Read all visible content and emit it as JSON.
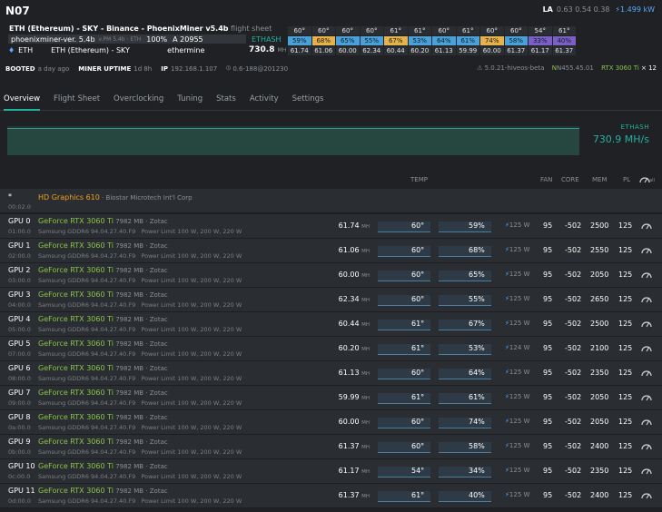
{
  "rig": {
    "name": "N07"
  },
  "la": {
    "label": "LA",
    "values": "0.63 0.54 0.38",
    "power": "⚡1.499 kW"
  },
  "flight_sheet": {
    "title": "ETH (Ethereum) - SKY - Binance - PhoenixMiner v5.4b",
    "suffix": "flight sheet"
  },
  "miner": {
    "name": "phoenixminer-ver. 5.4b",
    "version": "v.PM 5.4b · ETH",
    "percent": "100%",
    "accepted": "A 20955",
    "coin": "ETH",
    "coin_name": "ETH (Ethereum) - SKY",
    "pool": "ethermine",
    "algo": "ETHASH",
    "hashrate": "730.8",
    "hashrate_unit": "MH"
  },
  "gpu_summary": {
    "temps": [
      "60°",
      "60°",
      "60°",
      "60°",
      "61°",
      "61°",
      "60°",
      "61°",
      "60°",
      "60°",
      "54°",
      "61°"
    ],
    "fans": [
      "59%",
      "68%",
      "65%",
      "55%",
      "67%",
      "53%",
      "64%",
      "61%",
      "74%",
      "58%",
      "33%",
      "40%"
    ],
    "fan_colors": [
      "#4aa0d8",
      "#e8b24a",
      "#4aa0d8",
      "#4aa0d8",
      "#e8b24a",
      "#4aa0d8",
      "#4aa0d8",
      "#4aa0d8",
      "#e8b24a",
      "#4aa0d8",
      "#7b5fc4",
      "#7b5fc4"
    ],
    "hashrates": [
      "61.74",
      "61.06",
      "60.00",
      "62.34",
      "60.44",
      "60.20",
      "61.13",
      "59.99",
      "60.00",
      "61.37",
      "61.17",
      "61.37"
    ]
  },
  "info": {
    "booted_label": "BOOTED",
    "booted": "a day ago",
    "uptime_label": "MINER UPTIME",
    "uptime": "1d 8h",
    "ip_label": "IP",
    "ip": "192.168.1.107",
    "build": "0.6-188@201230",
    "os": "5.0.21-hiveos-beta",
    "driver": "N455.45.01",
    "gpu_model": "RTX 3060 Ti",
    "gpu_count": "× 12"
  },
  "tabs": [
    "Overview",
    "Flight Sheet",
    "Overclocking",
    "Tuning",
    "Stats",
    "Activity",
    "Settings"
  ],
  "chart": {
    "algo": "ETHASH",
    "hashrate": "730.9 MH/s"
  },
  "columns": {
    "temp": "TEMP",
    "fan": "FAN",
    "core": "CORE",
    "mem": "MEM",
    "pl": "PL",
    "all": "all"
  },
  "igpu": {
    "id": "*",
    "bus": "00:02.0",
    "name": "HD Graphics 610",
    "vendor": " · Biostar Microtech Int'l Corp"
  },
  "gpus": [
    {
      "id": "GPU 0",
      "bus": "01:00.0",
      "name": "GeForce RTX 3060 Ti",
      "mem_info": " 7982 MB · Zotac",
      "mem": "Samsung GDDR6 94.04.27.40.F9",
      "limit": "Power Limit 100 W, 200 W, 220 W",
      "hr": "61.74",
      "unit": "MH",
      "temp": "60°",
      "fan": "59%",
      "power": "125 W",
      "pct": "95",
      "core": "-502",
      "memclk": "2500",
      "pl": "125"
    },
    {
      "id": "GPU 1",
      "bus": "02:00.0",
      "name": "GeForce RTX 3060 Ti",
      "mem_info": " 7982 MB · Zotac",
      "mem": "Samsung GDDR6 94.04.27.40.F9",
      "limit": "Power Limit 100 W, 200 W, 220 W",
      "hr": "61.06",
      "unit": "MH",
      "temp": "60°",
      "fan": "68%",
      "power": "125 W",
      "pct": "95",
      "core": "-502",
      "memclk": "2550",
      "pl": "125"
    },
    {
      "id": "GPU 2",
      "bus": "03:00.0",
      "name": "GeForce RTX 3060 Ti",
      "mem_info": " 7982 MB · Zotac",
      "mem": "Samsung GDDR6 94.04.27.40.F9",
      "limit": "Power Limit 100 W, 200 W, 220 W",
      "hr": "60.00",
      "unit": "MH",
      "temp": "60°",
      "fan": "65%",
      "power": "125 W",
      "pct": "95",
      "core": "-502",
      "memclk": "2050",
      "pl": "125"
    },
    {
      "id": "GPU 3",
      "bus": "04:00.0",
      "name": "GeForce RTX 3060 Ti",
      "mem_info": " 7982 MB · Zotac",
      "mem": "Samsung GDDR6 94.04.27.40.F9",
      "limit": "Power Limit 100 W, 200 W, 220 W",
      "hr": "62.34",
      "unit": "MH",
      "temp": "60°",
      "fan": "55%",
      "power": "125 W",
      "pct": "95",
      "core": "-502",
      "memclk": "2650",
      "pl": "125"
    },
    {
      "id": "GPU 4",
      "bus": "05:00.0",
      "name": "GeForce RTX 3060 Ti",
      "mem_info": " 7982 MB · Zotac",
      "mem": "Samsung GDDR6 94.04.27.40.F9",
      "limit": "Power Limit 100 W, 200 W, 220 W",
      "hr": "60.44",
      "unit": "MH",
      "temp": "61°",
      "fan": "67%",
      "power": "125 W",
      "pct": "95",
      "core": "-502",
      "memclk": "2500",
      "pl": "125"
    },
    {
      "id": "GPU 5",
      "bus": "07:00.0",
      "name": "GeForce RTX 3060 Ti",
      "mem_info": " 7982 MB · Zotac",
      "mem": "Samsung GDDR6 94.04.27.40.F9",
      "limit": "Power Limit 100 W, 200 W, 220 W",
      "hr": "60.20",
      "unit": "MH",
      "temp": "61°",
      "fan": "53%",
      "power": "124 W",
      "pct": "95",
      "core": "-502",
      "memclk": "2100",
      "pl": "125"
    },
    {
      "id": "GPU 6",
      "bus": "08:00.0",
      "name": "GeForce RTX 3060 Ti",
      "mem_info": " 7982 MB · Zotac",
      "mem": "Samsung GDDR6 94.04.27.40.F9",
      "limit": "Power Limit 100 W, 200 W, 220 W",
      "hr": "61.13",
      "unit": "MH",
      "temp": "60°",
      "fan": "64%",
      "power": "125 W",
      "pct": "95",
      "core": "-502",
      "memclk": "2350",
      "pl": "125"
    },
    {
      "id": "GPU 7",
      "bus": "09:00.0",
      "name": "GeForce RTX 3060 Ti",
      "mem_info": " 7982 MB · Zotac",
      "mem": "Samsung GDDR6 94.04.27.40.F9",
      "limit": "Power Limit 100 W, 200 W, 220 W",
      "hr": "59.99",
      "unit": "MH",
      "temp": "61°",
      "fan": "61%",
      "power": "125 W",
      "pct": "95",
      "core": "-502",
      "memclk": "2050",
      "pl": "125"
    },
    {
      "id": "GPU 8",
      "bus": "0a:00.0",
      "name": "GeForce RTX 3060 Ti",
      "mem_info": " 7982 MB · Zotac",
      "mem": "Samsung GDDR6 94.04.27.40.F9",
      "limit": "Power Limit 100 W, 200 W, 220 W",
      "hr": "60.00",
      "unit": "MH",
      "temp": "60°",
      "fan": "74%",
      "power": "125 W",
      "pct": "95",
      "core": "-502",
      "memclk": "2050",
      "pl": "125"
    },
    {
      "id": "GPU 9",
      "bus": "0b:00.0",
      "name": "GeForce RTX 3060 Ti",
      "mem_info": " 7982 MB · Zotac",
      "mem": "Samsung GDDR6 94.04.27.40.F9",
      "limit": "Power Limit 100 W, 200 W, 220 W",
      "hr": "61.37",
      "unit": "MH",
      "temp": "60°",
      "fan": "58%",
      "power": "125 W",
      "pct": "95",
      "core": "-502",
      "memclk": "2400",
      "pl": "125"
    },
    {
      "id": "GPU 10",
      "bus": "0c:00.0",
      "name": "GeForce RTX 3060 Ti",
      "mem_info": " 7982 MB · Zotac",
      "mem": "Samsung GDDR6 94.04.27.40.F9",
      "limit": "Power Limit 100 W, 200 W, 220 W",
      "hr": "61.17",
      "unit": "MH",
      "temp": "54°",
      "fan": "34%",
      "power": "125 W",
      "pct": "95",
      "core": "-502",
      "memclk": "2350",
      "pl": "125"
    },
    {
      "id": "GPU 11",
      "bus": "0d:00.0",
      "name": "GeForce RTX 3060 Ti",
      "mem_info": " 7982 MB · Zotac",
      "mem": "Samsung GDDR6 94.04.27.40.F9",
      "limit": "Power Limit 100 W, 200 W, 220 W",
      "hr": "61.37",
      "unit": "MH",
      "temp": "61°",
      "fan": "40%",
      "power": "125 W",
      "pct": "95",
      "core": "-502",
      "memclk": "2400",
      "pl": "125"
    }
  ]
}
